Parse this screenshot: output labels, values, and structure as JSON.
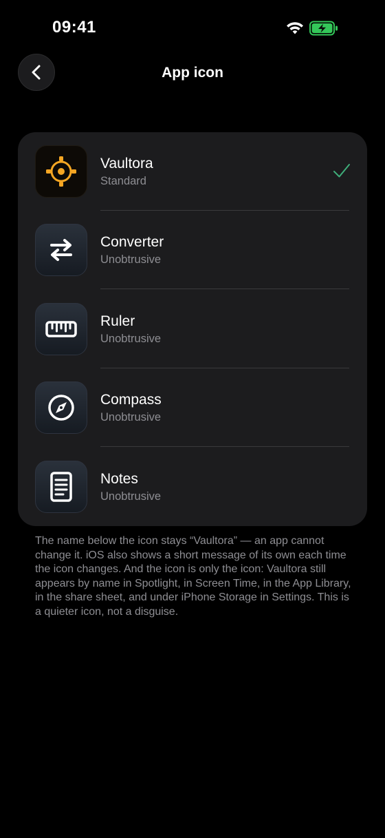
{
  "status_bar": {
    "time": "09:41"
  },
  "nav": {
    "title": "App icon"
  },
  "icons": [
    {
      "name": "Vaultora",
      "subtitle": "Standard",
      "icon": "crosshair-icon",
      "selected": true
    },
    {
      "name": "Converter",
      "subtitle": "Unobtrusive",
      "icon": "arrows-swap-icon",
      "selected": false
    },
    {
      "name": "Ruler",
      "subtitle": "Unobtrusive",
      "icon": "ruler-icon",
      "selected": false
    },
    {
      "name": "Compass",
      "subtitle": "Unobtrusive",
      "icon": "compass-icon",
      "selected": false
    },
    {
      "name": "Notes",
      "subtitle": "Unobtrusive",
      "icon": "notes-icon",
      "selected": false
    }
  ],
  "footnote": "The name below the icon stays “Vaultora” — an app cannot change it. iOS also shows a short message of its own each time the icon changes. And the icon is only the icon: Vaultora still appears by name in Spotlight, in Screen Time, in the App Library, in the share sheet, and under iPhone Storage in Settings. This is a quieter icon, not a disguise.",
  "colors": {
    "background": "#000000",
    "card": "#1c1c1e",
    "brand_orange": "#f5a623",
    "check_green": "#3fae7a",
    "battery_green": "#34c759",
    "secondary_text": "#8e8e93"
  }
}
